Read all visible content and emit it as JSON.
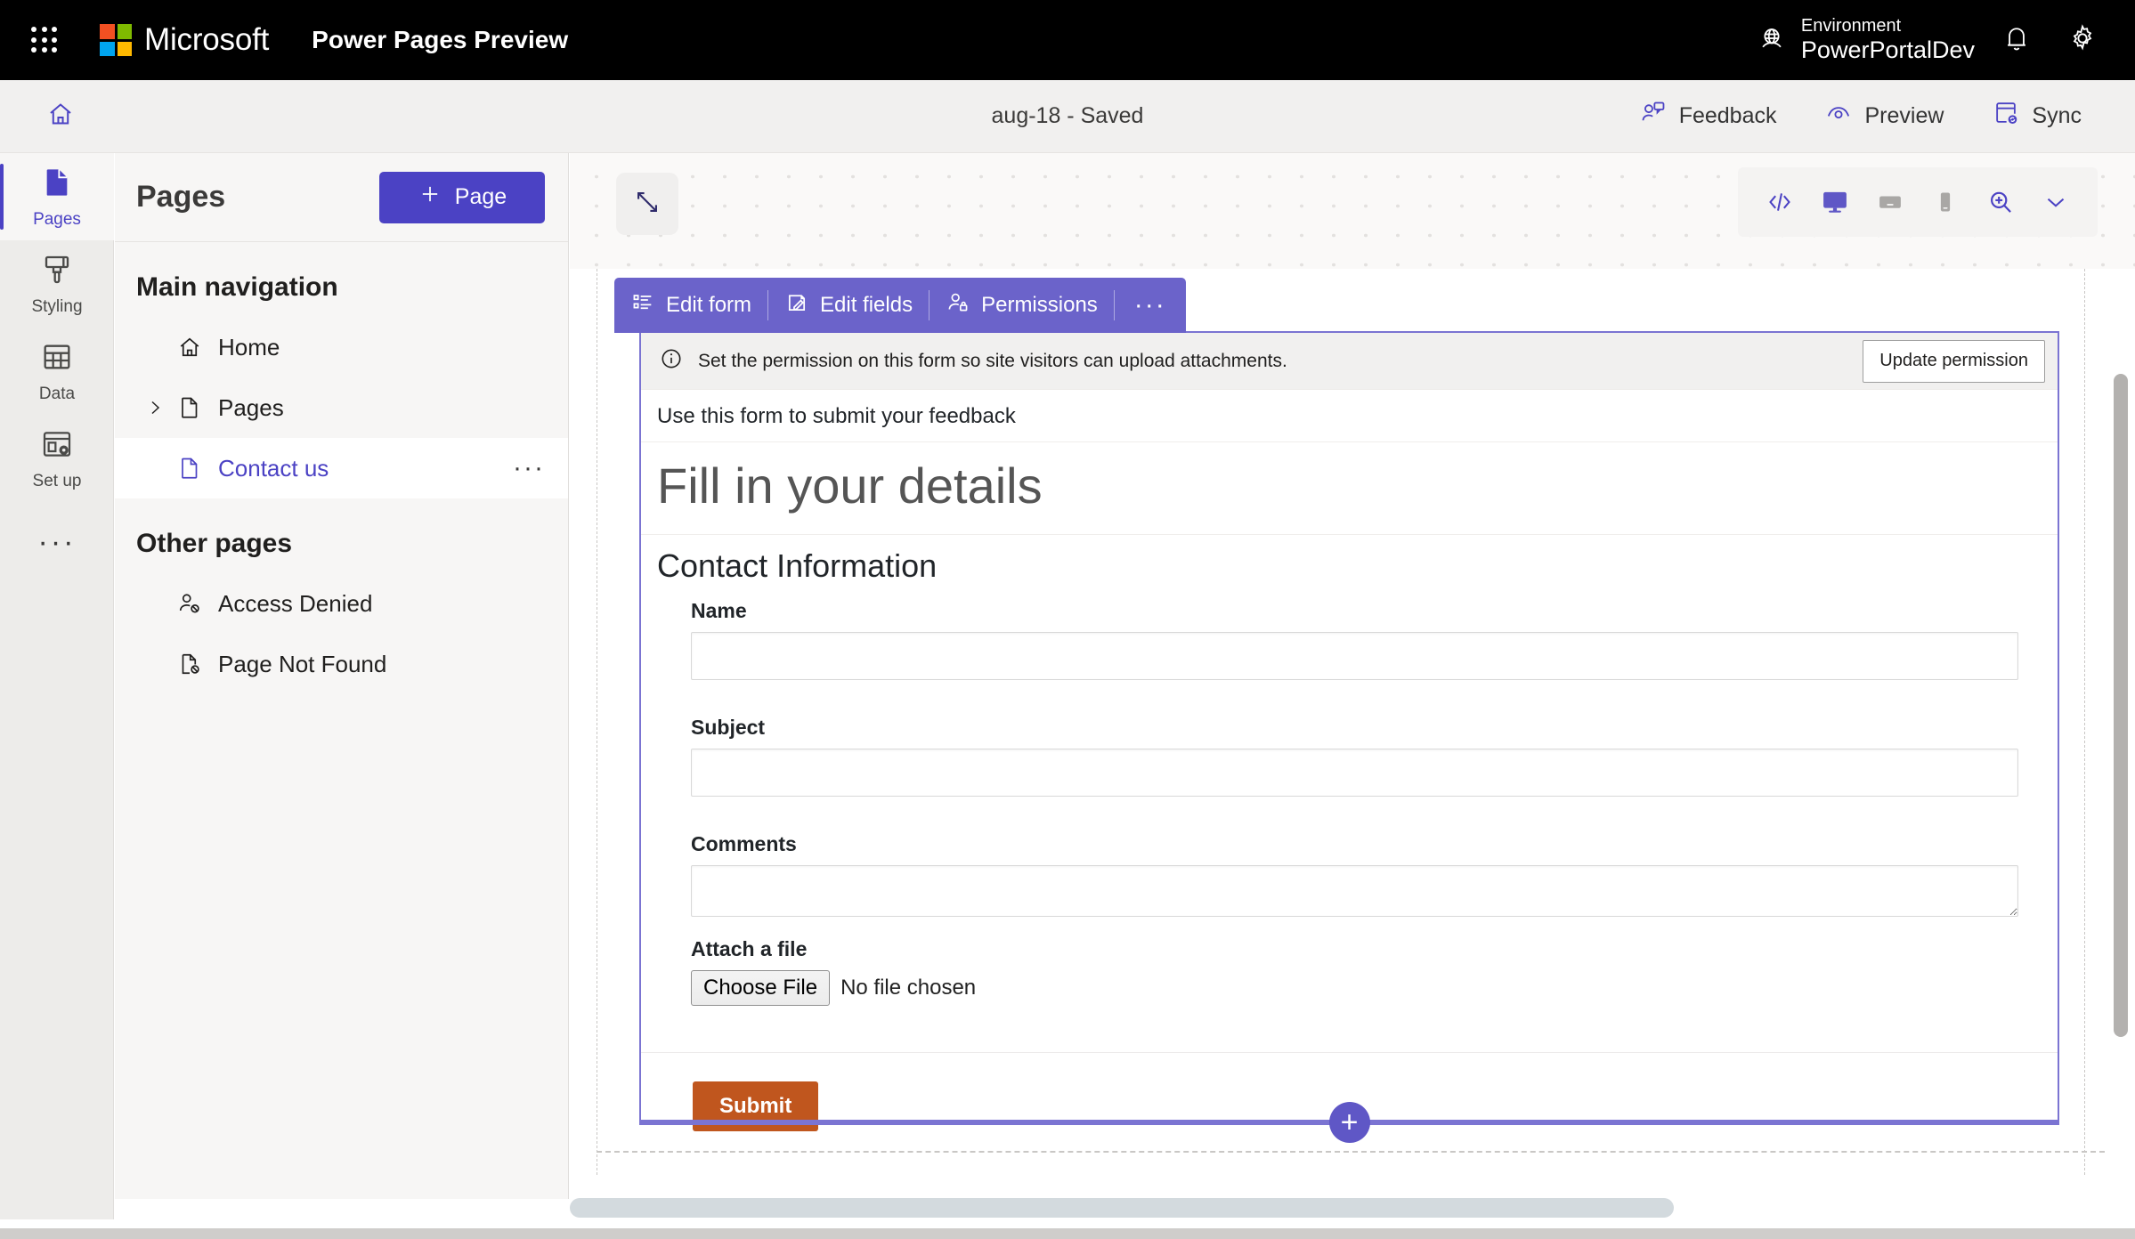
{
  "topbar": {
    "waffle_label": "app-launcher",
    "brand": "Microsoft",
    "app_name": "Power Pages Preview",
    "environment_label": "Environment",
    "environment_name": "PowerPortalDev",
    "notifications_label": "Notifications",
    "settings_label": "Settings"
  },
  "subbar": {
    "home_label": "Home",
    "site_title": "aug-18 - Saved",
    "actions": [
      {
        "label": "Feedback",
        "icon": "feedback-icon"
      },
      {
        "label": "Preview",
        "icon": "preview-icon"
      },
      {
        "label": "Sync",
        "icon": "sync-icon"
      }
    ]
  },
  "rail": {
    "items": [
      {
        "label": "Pages",
        "icon": "page-icon",
        "active": true
      },
      {
        "label": "Styling",
        "icon": "brush-icon",
        "active": false
      },
      {
        "label": "Data",
        "icon": "table-icon",
        "active": false
      },
      {
        "label": "Set up",
        "icon": "setup-icon",
        "active": false
      }
    ],
    "more_label": "More"
  },
  "panel": {
    "title": "Pages",
    "new_page_button": "Page",
    "sections": [
      {
        "title": "Main navigation",
        "items": [
          {
            "label": "Home",
            "icon": "home-icon",
            "expandable": false,
            "selected": false
          },
          {
            "label": "Pages",
            "icon": "page-icon",
            "expandable": true,
            "selected": false
          },
          {
            "label": "Contact us",
            "icon": "page-icon",
            "expandable": false,
            "selected": true,
            "more": "···"
          }
        ]
      },
      {
        "title": "Other pages",
        "items": [
          {
            "label": "Access Denied",
            "icon": "person-blocked-icon",
            "expandable": false,
            "selected": false
          },
          {
            "label": "Page Not Found",
            "icon": "page-blocked-icon",
            "expandable": false,
            "selected": false
          }
        ]
      }
    ]
  },
  "canvas": {
    "expand_label": "Expand canvas",
    "device_buttons": [
      {
        "name": "code-icon",
        "label": "Code editor",
        "active": false
      },
      {
        "name": "desktop-icon",
        "label": "Desktop",
        "active": true
      },
      {
        "name": "tablet-icon",
        "label": "Tablet",
        "active": false
      },
      {
        "name": "mobile-icon",
        "label": "Mobile",
        "active": false
      },
      {
        "name": "zoom-in-icon",
        "label": "Zoom",
        "active": false
      },
      {
        "name": "chevron-down-icon",
        "label": "More zoom options",
        "active": false
      }
    ]
  },
  "form_toolbar": {
    "buttons": [
      {
        "label": "Edit form",
        "icon": "edit-form-icon"
      },
      {
        "label": "Edit fields",
        "icon": "edit-fields-icon"
      },
      {
        "label": "Permissions",
        "icon": "permissions-icon"
      }
    ],
    "more": "···"
  },
  "permission_bar": {
    "icon": "info-icon",
    "message": "Set the permission on this form so site visitors can upload attachments.",
    "button": "Update permission"
  },
  "form": {
    "intro": "Use this form to submit your feedback",
    "heading": "Fill in your details",
    "subheading": "Contact Information",
    "fields": [
      {
        "label": "Name",
        "type": "text",
        "value": "",
        "placeholder": ""
      },
      {
        "label": "Subject",
        "type": "text",
        "value": "",
        "placeholder": ""
      },
      {
        "label": "Comments",
        "type": "textarea",
        "value": "",
        "placeholder": ""
      }
    ],
    "attach": {
      "label": "Attach a file",
      "choose_button": "Choose File",
      "status": "No file chosen"
    },
    "submit_label": "Submit",
    "add_section_label": "+"
  },
  "colors": {
    "accent": "#4b42c4",
    "form_accent": "#7b74d2",
    "submit": "#c0561e",
    "topbar_bg": "#000000",
    "panel_bg": "#f7f6f5"
  }
}
